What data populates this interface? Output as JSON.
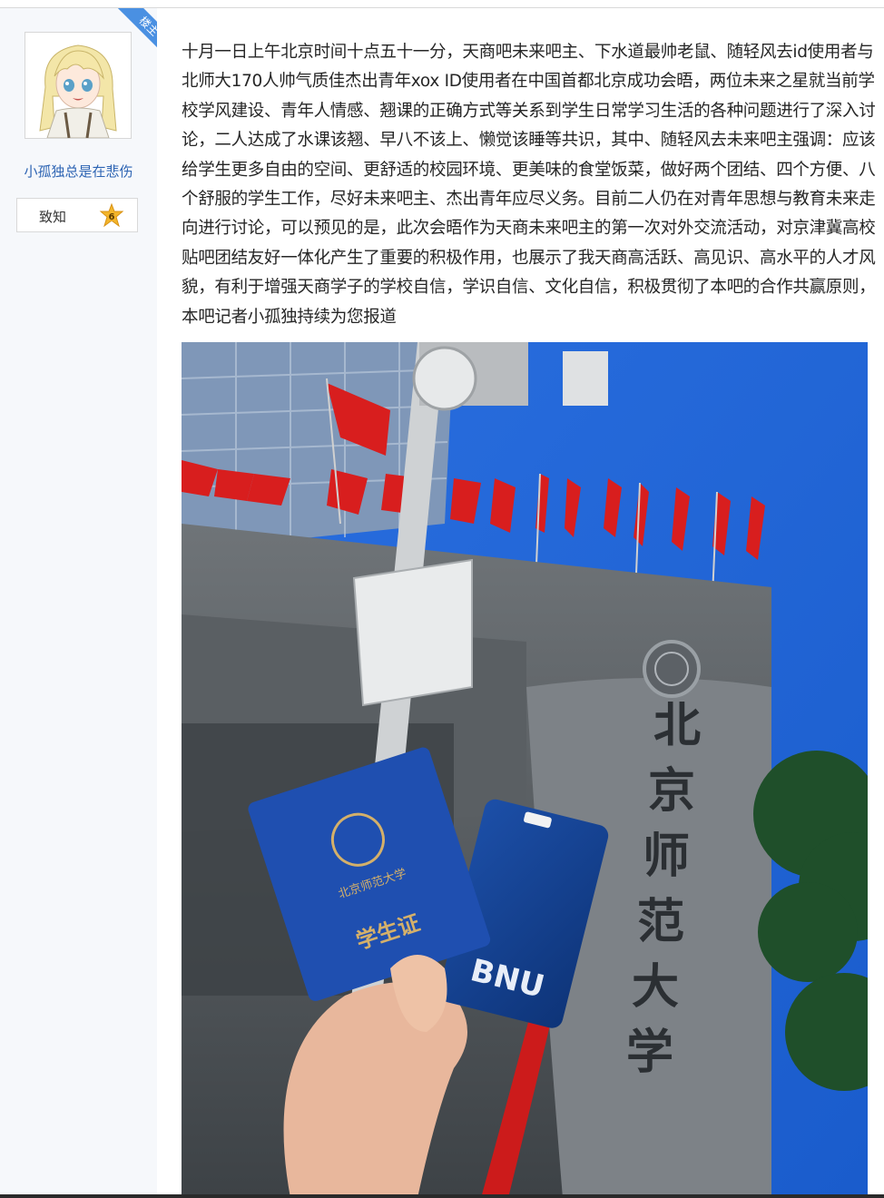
{
  "floor_badge": "楼主",
  "user": {
    "name": "小孤独总是在悲伤",
    "level_name": "致知",
    "level_num": "6"
  },
  "post": {
    "text": "十月一日上午北京时间十点五十一分，天商吧未来吧主、下水道最帅老鼠、随轻风去id使用者与北师大170人帅气质佳杰出青年xox ID使用者在中国首都北京成功会晤，两位未来之星就当前学校学风建设、青年人情感、翘课的正确方式等关系到学生日常学习生活的各种问题进行了深入讨论，二人达成了水课该翘、早八不该上、懒觉该睡等共识，其中、随轻风去未来吧主强调：应该给学生更多自由的空间、更舒适的校园环境、更美味的食堂饭菜，做好两个团结、四个方便、八个舒服的学生工作，尽好未来吧主、杰出青年应尽义务。目前二人仍在对青年思想与教育未来走向进行讨论，可以预见的是，此次会晤作为天商未来吧主的第一次对外交流活动，对京津冀高校贴吧团结友好一体化产生了重要的积极作用，也展示了我天商高活跃、高见识、高水平的人才风貌，有利于增强天商学子的学校自信，学识自信、文化自信，积极贯彻了本吧的合作共赢原则，本吧记者小孤独持续为您报道"
  },
  "photo": {
    "wall_text": "北京师范大学",
    "card_text": "BNU",
    "card_title": "学生证",
    "card_school": "北京师范大学"
  },
  "colors": {
    "link": "#2d64b3",
    "badge": "#4a90e2",
    "sky": "#1f64d6",
    "flag": "#d81e1e"
  }
}
